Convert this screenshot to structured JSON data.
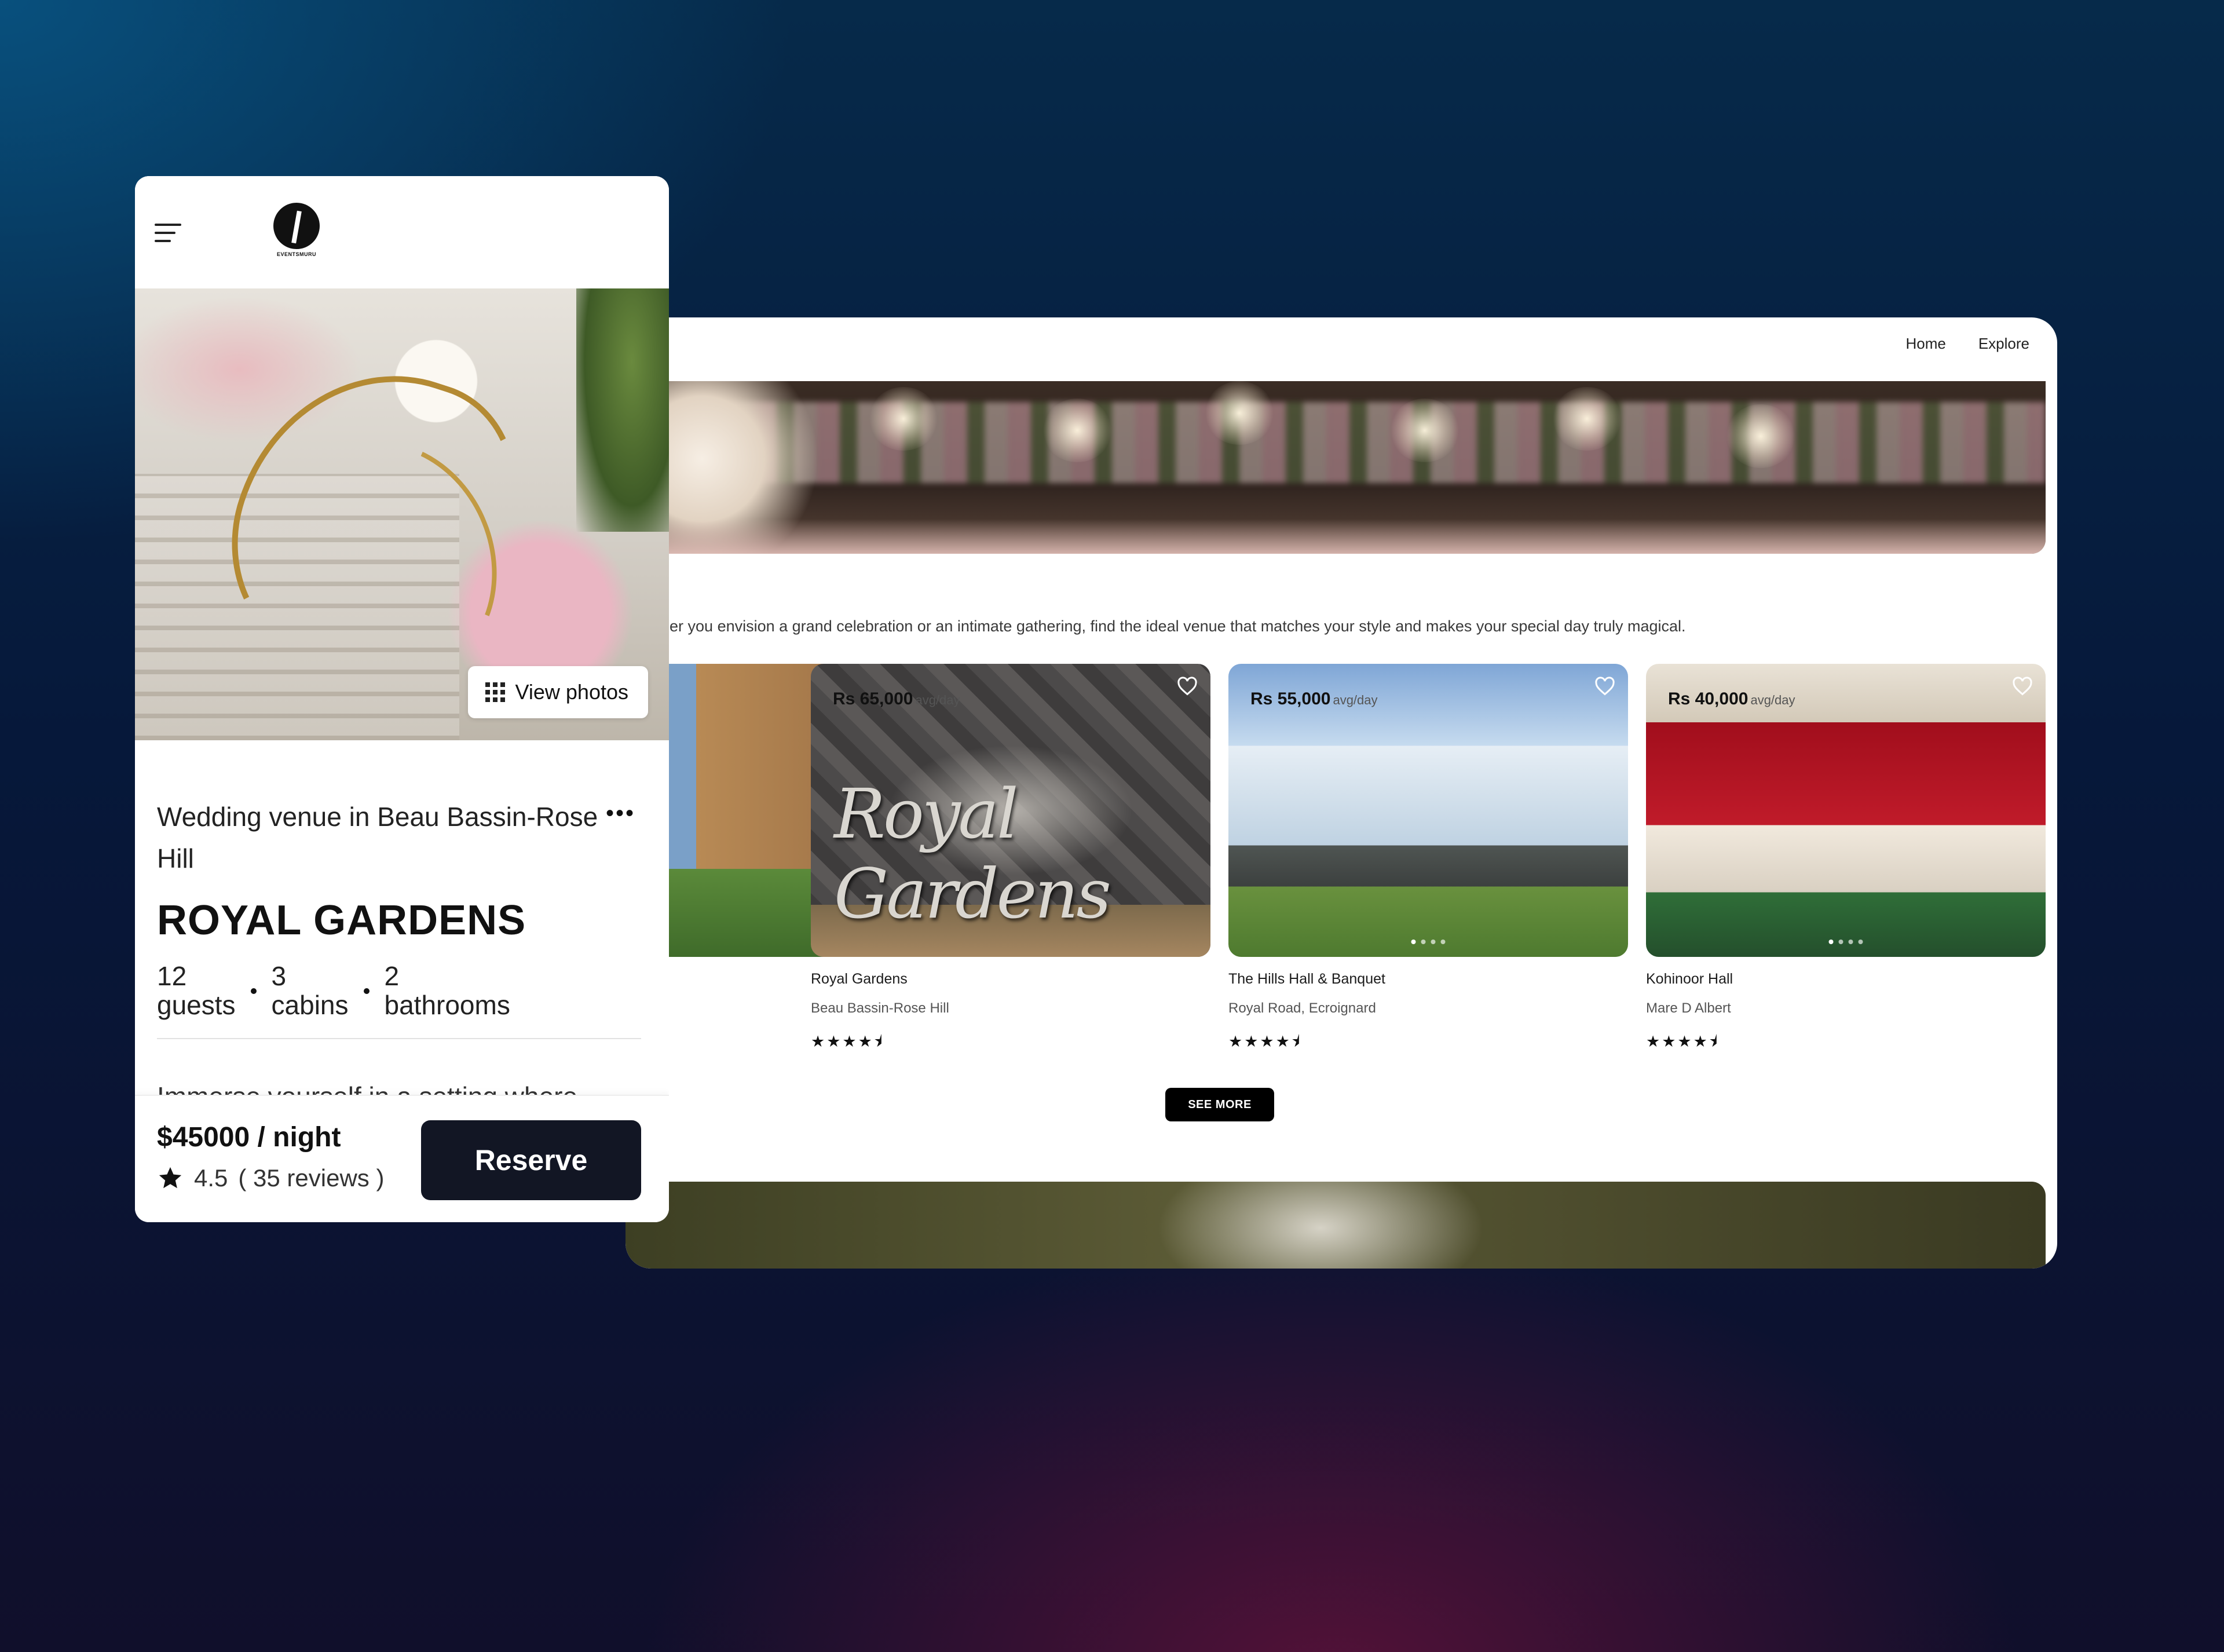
{
  "desktop": {
    "nav": [
      {
        "label": "Home"
      },
      {
        "label": "Explore"
      }
    ],
    "tagline": "Whether you envision a grand celebration or an intimate gathering, find the ideal venue that matches your style and makes your special day truly magical.",
    "see_more_label": "SEE MORE",
    "venues": [
      {
        "name": "",
        "location": "",
        "price": "",
        "unit": "",
        "rating_stars": "★★★★⯨"
      },
      {
        "name": "Royal Gardens",
        "location": "Beau Bassin-Rose Hill",
        "price": "Rs 65,000",
        "unit": "avg/day",
        "rating_stars": "★★★★⯨",
        "image_text": "Royal Gardens"
      },
      {
        "name": "The Hills Hall & Banquet",
        "location": "Royal Road, Ecroignard",
        "price": "Rs 55,000",
        "unit": "avg/day",
        "rating_stars": "★★★★⯨"
      },
      {
        "name": "Kohinoor Hall",
        "location": "Mare D Albert",
        "price": "Rs 40,000",
        "unit": "avg/day",
        "rating_stars": "★★★★⯨"
      }
    ]
  },
  "mobile": {
    "logo_text": "EVENTSMURU",
    "view_photos_label": "View photos",
    "venue_type": "Wedding venue in Beau Bassin-Rose Hill",
    "title": "ROYAL GARDENS",
    "specs": [
      {
        "num": "12",
        "unit": "guests"
      },
      {
        "num": "3",
        "unit": "cabins"
      },
      {
        "num": "2",
        "unit": "bathrooms"
      }
    ],
    "description": "Immerse yourself in a setting where nature and romance intertwine",
    "price": "$45000 / night",
    "rating": "4.5",
    "reviews": "( 35 reviews )",
    "reserve_label": "Reserve"
  },
  "icons": {
    "menu": "hamburger-icon",
    "grid": "grid-icon",
    "more": "more-horizontal-icon",
    "star": "star-icon",
    "heart": "heart-icon"
  }
}
